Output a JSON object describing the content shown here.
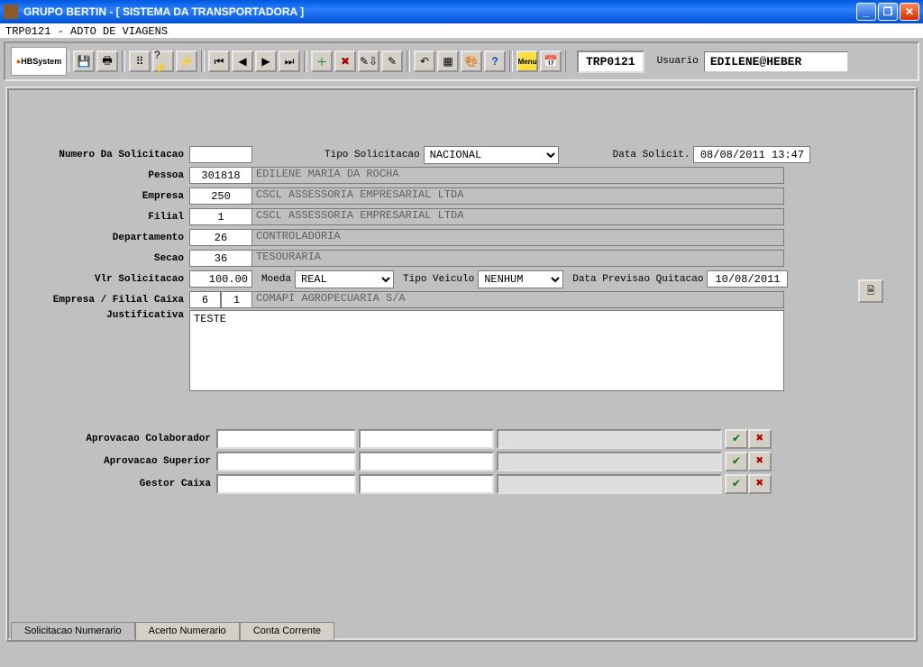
{
  "window": {
    "title": "GRUPO BERTIN - [ SISTEMA DA TRANSPORTADORA ]",
    "subtitle": "TRP0121 - ADTO DE VIAGENS"
  },
  "toolbar": {
    "logo": "HBSystem",
    "screen_code": "TRP0121",
    "usuario_label": "Usuario",
    "usuario_value": "EDILENE@HEBER"
  },
  "form": {
    "labels": {
      "numero": "Numero Da Solicitacao",
      "tipo": "Tipo Solicitacao",
      "data_solicit": "Data Solicit.",
      "pessoa": "Pessoa",
      "empresa": "Empresa",
      "filial": "Filial",
      "departamento": "Departamento",
      "secao": "Secao",
      "vlr": "Vlr Solicitacao",
      "moeda": "Moeda",
      "tipo_veiculo": "Tipo Veiculo",
      "data_prev": "Data Previsao Quitacao",
      "emp_filial_caixa": "Empresa / Filial Caixa",
      "justificativa": "Justificativa"
    },
    "values": {
      "numero": "",
      "tipo": "NACIONAL",
      "data_solicit": "08/08/2011 13:47",
      "pessoa_cod": "301818",
      "pessoa_nome": "EDILENE MARIA DA ROCHA",
      "empresa_cod": "250",
      "empresa_nome": "CSCL ASSESSORIA EMPRESARIAL LTDA",
      "filial_cod": "1",
      "filial_nome": "CSCL ASSESSORIA EMPRESARIAL LTDA",
      "departamento_cod": "26",
      "departamento_nome": "CONTROLADORIA",
      "secao_cod": "36",
      "secao_nome": "TESOURARIA",
      "vlr": "100.00",
      "moeda": "REAL",
      "tipo_veiculo": "NENHUM",
      "data_prev": "10/08/2011",
      "emp_caixa": "6",
      "filial_caixa": "1",
      "caixa_nome": "COMAPI  AGROPECUARIA S/A",
      "justificativa": "TESTE"
    }
  },
  "approvals": {
    "labels": {
      "colab": "Aprovacao Colaborador",
      "superior": "Aprovacao Superior",
      "gestor": "Gestor Caixa"
    }
  },
  "tabs": {
    "t1": "Solicitacao Numerario",
    "t2": "Acerto Numerario",
    "t3": "Conta Corrente"
  }
}
